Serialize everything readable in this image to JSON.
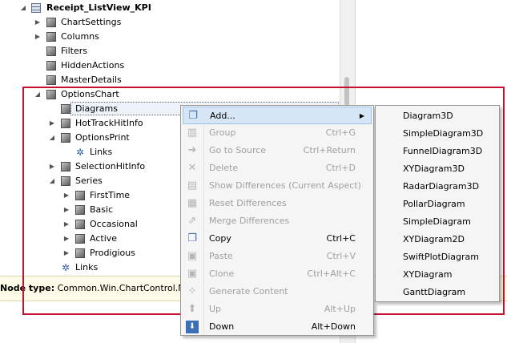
{
  "tree": {
    "root": "Receipt_ListView_KPI",
    "chart_settings": "ChartSettings",
    "columns": "Columns",
    "filters": "Filters",
    "hidden_actions": "HiddenActions",
    "master_details": "MasterDetails",
    "options_chart": "OptionsChart",
    "diagrams": "Diagrams",
    "hot_track_hit_info": "HotTrackHitInfo",
    "options_print": "OptionsPrint",
    "options_print_links": "Links",
    "selection_hit_info": "SelectionHitInfo",
    "series": "Series",
    "first_time": "FirstTime",
    "basic": "Basic",
    "occasional": "Occasional",
    "active": "Active",
    "prodigious": "Prodigious",
    "links": "Links"
  },
  "status_bar": {
    "label": "Node type:",
    "value": "Common.Win.ChartControl.Mode"
  },
  "context_menu": {
    "add": {
      "label": "Add...",
      "shortcut": ""
    },
    "group": {
      "label": "Group",
      "shortcut": "Ctrl+G"
    },
    "go_to_source": {
      "label": "Go to Source",
      "shortcut": "Ctrl+Return"
    },
    "delete": {
      "label": "Delete",
      "shortcut": "Ctrl+D"
    },
    "show_differences": {
      "label": "Show Differences (Current Aspect)",
      "shortcut": ""
    },
    "reset_differences": {
      "label": "Reset Differences",
      "shortcut": ""
    },
    "merge_differences": {
      "label": "Merge Differences",
      "shortcut": ""
    },
    "copy": {
      "label": "Copy",
      "shortcut": "Ctrl+C"
    },
    "paste": {
      "label": "Paste",
      "shortcut": "Ctrl+V"
    },
    "clone": {
      "label": "Clone",
      "shortcut": "Ctrl+Alt+C"
    },
    "generate_content": {
      "label": "Generate Content",
      "shortcut": ""
    },
    "up": {
      "label": "Up",
      "shortcut": "Alt+Up"
    },
    "down": {
      "label": "Down",
      "shortcut": "Alt+Down"
    }
  },
  "submenu": {
    "items": [
      "Diagram3D",
      "SimpleDiagram3D",
      "FunnelDiagram3D",
      "XYDiagram3D",
      "RadarDiagram3D",
      "PollarDiagram",
      "SimpleDiagram",
      "XYDiagram2D",
      "SwiftPlotDiagram",
      "XYDiagram",
      "GanttDiagram"
    ]
  },
  "colors": {
    "highlight_frame": "#c8102e",
    "menu_hover": "#d6e6f7",
    "status_background": "#fdfbe7"
  }
}
